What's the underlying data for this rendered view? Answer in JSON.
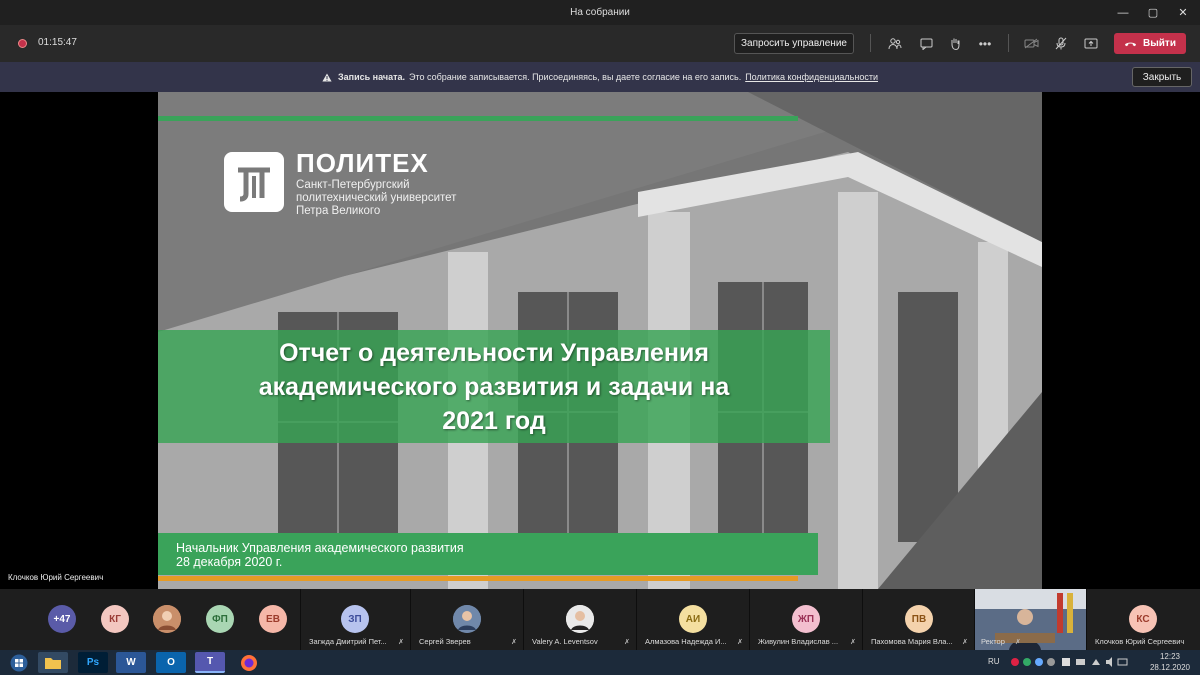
{
  "window": {
    "title": "На собрании",
    "min": "—",
    "max": "▢",
    "close": "✕"
  },
  "toolbar": {
    "timer": "01:15:47",
    "request_control": "Запросить управление",
    "more": "•••",
    "leave": "Выйти"
  },
  "banner": {
    "bold": "Запись начата.",
    "text": "Это собрание записывается. Присоединяясь, вы даете согласие на его запись.",
    "link": "Политика конфиденциальности",
    "close": "Закрыть"
  },
  "slide": {
    "logo_big": "ПОЛИТЕХ",
    "logo_line1": "Санкт-Петербургский",
    "logo_line2": "политехнический университет",
    "logo_line3": "Петра Великого",
    "title": "Отчет о деятельности Управления\nакадемического развития и задачи на\n2021 год",
    "subtitle1": "Начальник Управления академического развития",
    "subtitle2": "28 декабря 2020 г."
  },
  "speaker": "Клочков Юрий Сергеевич",
  "participants": {
    "more": "+47",
    "avatars": [
      "КГ",
      "ФП",
      "ЕВ"
    ],
    "tiles": [
      {
        "initials": "ЗП",
        "name": "Загжда Дмитрий Пет..."
      },
      {
        "initials": "",
        "name": "Сергей Зверев"
      },
      {
        "initials": "",
        "name": "Valery A. Leventsov"
      },
      {
        "initials": "АИ",
        "name": "Алмазова Надежда И..."
      },
      {
        "initials": "ЖП",
        "name": "Живулин Владислав ..."
      },
      {
        "initials": "ПВ",
        "name": "Пахомова Мария Вла..."
      },
      {
        "initials": "",
        "name": "Ректор"
      },
      {
        "initials": "КС",
        "name": "Клочков Юрий Сергеевич"
      }
    ]
  },
  "taskbar": {
    "apps": [
      "Ps",
      "W",
      "O",
      "T"
    ],
    "lang": "RU",
    "time": "12:23",
    "date": "28.12.2020"
  }
}
